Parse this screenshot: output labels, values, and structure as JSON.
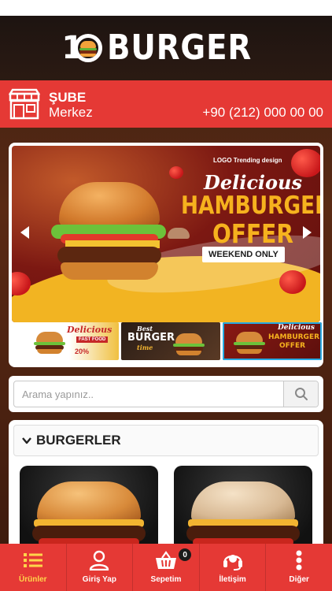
{
  "app": {
    "logo_number": "1",
    "logo_word": "BURGER"
  },
  "branch": {
    "label": "ŞUBE",
    "name": "Merkez",
    "phone": "+90 (212) 000 00 00",
    "icon": "store-icon"
  },
  "banner": {
    "logo_text": "LOGO Trending design",
    "headline_script": "Delicious",
    "headline_main": "HAMBURGER",
    "headline_sub": "OFFER",
    "tag": "WEEKEND ONLY",
    "thumbnails": [
      {
        "script": "Delicious",
        "line1": "FAST FOOD",
        "line2": "20%"
      },
      {
        "script": "Best",
        "line1": "BURGER",
        "line2": "time"
      },
      {
        "script": "Delicious",
        "line1": "HAMBURGER",
        "line2": "OFFER"
      }
    ]
  },
  "search": {
    "placeholder": "Arama yapınız.."
  },
  "category": {
    "title": "BURGERLER"
  },
  "tabbar": {
    "items": [
      {
        "label": "Ürünler",
        "icon": "list-icon",
        "active": true
      },
      {
        "label": "Giriş Yap",
        "icon": "user-icon",
        "active": false
      },
      {
        "label": "Sepetim",
        "icon": "basket-icon",
        "active": false,
        "badge": "0"
      },
      {
        "label": "İletişim",
        "icon": "headset-icon",
        "active": false
      },
      {
        "label": "Diğer",
        "icon": "more-vertical-icon",
        "active": false
      }
    ]
  },
  "colors": {
    "brand_red": "#e53935",
    "active_tab": "#ffd54a",
    "header_dark": "#1d1411"
  }
}
